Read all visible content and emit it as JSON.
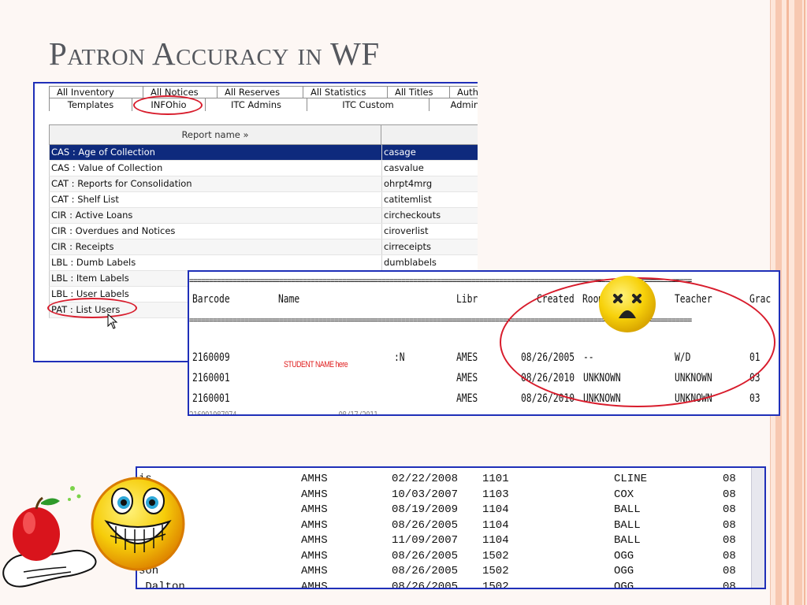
{
  "slide": {
    "title": "Patron Accuracy in WF"
  },
  "report_window": {
    "tabs_row1": [
      "All Inventory",
      "All Notices",
      "All Reserves",
      "All Statistics",
      "All Titles",
      "Authori"
    ],
    "tabs_row2": [
      "Templates",
      "INFOhio",
      "ITC Admins",
      "ITC Custom",
      "Administr"
    ],
    "highlighted_tab": "INFOhio",
    "table": {
      "header": "Report name »",
      "rows": [
        {
          "name": "CAS : Age of Collection",
          "id": "casage",
          "selected": true
        },
        {
          "name": "CAS : Value of Collection",
          "id": "casvalue"
        },
        {
          "name": "CAT : Reports for Consolidation",
          "id": "ohrpt4mrg"
        },
        {
          "name": "CAT : Shelf List",
          "id": "catitemlist"
        },
        {
          "name": "CIR : Active Loans",
          "id": "circheckouts"
        },
        {
          "name": "CIR : Overdues and Notices",
          "id": "ciroverlist"
        },
        {
          "name": "CIR : Receipts",
          "id": "cirreceipts"
        },
        {
          "name": "LBL : Dumb Labels",
          "id": "dumblabels"
        },
        {
          "name": "LBL : Item Labels",
          "id": ""
        },
        {
          "name": "LBL : User Labels",
          "id": ""
        },
        {
          "name": "PAT : List Users",
          "id": ""
        }
      ],
      "highlighted_row": "PAT : List Users"
    },
    "icons": {
      "cursor": "mouse-pointer-icon"
    }
  },
  "bad_listing": {
    "headers": {
      "barcode": "Barcode",
      "name": "Name",
      "library": "Libr",
      "created": "Created",
      "room": "Room",
      "teacher": "Teacher",
      "grade": "Grac"
    },
    "student_placeholder": "STUDENT NAME here",
    "rows": [
      {
        "barcode": "2160009",
        "name": ":N",
        "library": "AMES",
        "created": "08/26/2005",
        "room": "--",
        "teacher": "W/D",
        "grade": "01"
      },
      {
        "barcode": "2160001",
        "name": "",
        "library": "AMES",
        "created": "08/26/2010",
        "room": "UNKNOWN",
        "teacher": "UNKNOWN",
        "grade": "03"
      },
      {
        "barcode": "2160001",
        "name": "",
        "library": "AMES",
        "created": "08/26/2010",
        "room": "UNKNOWN",
        "teacher": "UNKNOWN",
        "grade": "03"
      }
    ],
    "icons": {
      "reaction": "sad-face-icon"
    }
  },
  "good_listing": {
    "rows": [
      {
        "name": "is",
        "library": "AMHS",
        "created": "02/22/2008",
        "room": "1101",
        "teacher": "CLINE",
        "grade": "08"
      },
      {
        "name": "",
        "library": "AMHS",
        "created": "10/03/2007",
        "room": "1103",
        "teacher": "COX",
        "grade": "08"
      },
      {
        "name": "",
        "library": "AMHS",
        "created": "08/19/2009",
        "room": "1104",
        "teacher": "BALL",
        "grade": "08"
      },
      {
        "name": "",
        "library": "AMHS",
        "created": "08/26/2005",
        "room": "1104",
        "teacher": "BALL",
        "grade": "08"
      },
      {
        "name": "",
        "library": "AMHS",
        "created": "11/09/2007",
        "room": "1104",
        "teacher": "BALL",
        "grade": "08"
      },
      {
        "name": "",
        "library": "AMHS",
        "created": "08/26/2005",
        "room": "1502",
        "teacher": "OGG",
        "grade": "08"
      },
      {
        "name": "son",
        "library": "AMHS",
        "created": "08/26/2005",
        "room": "1502",
        "teacher": "OGG",
        "grade": "08"
      },
      {
        "name": " Dalton",
        "library": "AMHS",
        "created": "08/26/2005",
        "room": "1502",
        "teacher": "OGG",
        "grade": "08"
      }
    ],
    "icons": {
      "reaction": "happy-face-icon",
      "decoration": "apple-in-hand-icon"
    }
  },
  "colors": {
    "highlight_red": "#d81c2c",
    "frame_blue": "#1f2fb8",
    "selected_row": "#0e2a7d",
    "title_gray": "#55585e"
  }
}
